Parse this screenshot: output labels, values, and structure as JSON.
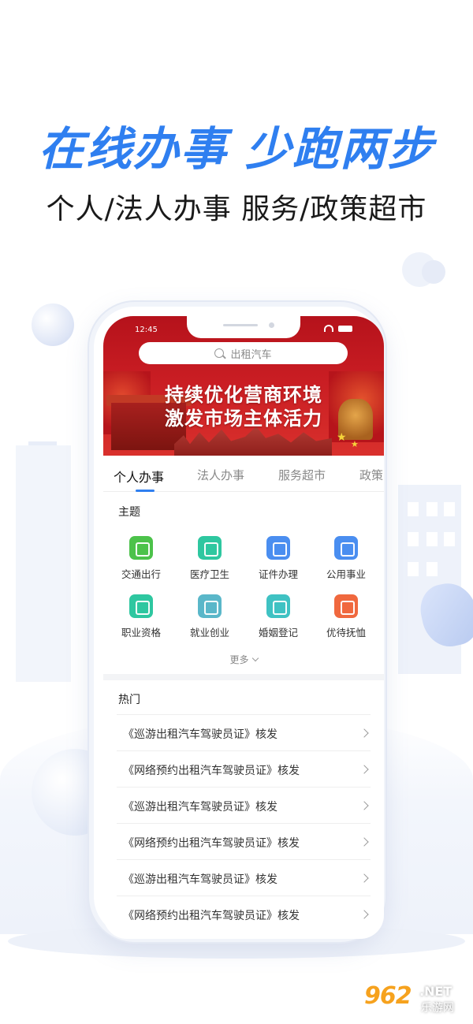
{
  "promo": {
    "headline": "在线办事  少跑两步",
    "subline": "个人/法人办事 服务/政策超市"
  },
  "status_bar": {
    "time": "12:45"
  },
  "search": {
    "placeholder": "出租汽车"
  },
  "banner": {
    "slogan_line1": "持续优化营商环境",
    "slogan_line2": "激发市场主体活力"
  },
  "tabs": [
    {
      "label": "个人办事",
      "active": true
    },
    {
      "label": "法人办事",
      "active": false
    },
    {
      "label": "服务超市",
      "active": false
    },
    {
      "label": "政策",
      "active": false
    }
  ],
  "themes": {
    "title": "主题",
    "items": [
      {
        "label": "交通出行",
        "icon": "car-icon",
        "color": "#4cc24a"
      },
      {
        "label": "医疗卫生",
        "icon": "medical-icon",
        "color": "#2ec7a0"
      },
      {
        "label": "证件办理",
        "icon": "id-card-icon",
        "color": "#4a8ef0"
      },
      {
        "label": "公用事业",
        "icon": "presentation-icon",
        "color": "#4a8ef0"
      },
      {
        "label": "职业资格",
        "icon": "certificate-icon",
        "color": "#2ec7a0"
      },
      {
        "label": "就业创业",
        "icon": "startup-icon",
        "color": "#5ab7c9"
      },
      {
        "label": "婚姻登记",
        "icon": "calendar-heart-icon",
        "color": "#3fc2c3"
      },
      {
        "label": "优待抚恤",
        "icon": "heart-hands-icon",
        "color": "#f0683e"
      }
    ],
    "more_label": "更多"
  },
  "hot": {
    "title": "热门",
    "items": [
      "《巡游出租汽车驾驶员证》核发",
      "《网络预约出租汽车驾驶员证》核发",
      "《巡游出租汽车驾驶员证》核发",
      "《网络预约出租汽车驾驶员证》核发",
      "《巡游出租汽车驾驶员证》核发",
      "《网络预约出租汽车驾驶员证》核发"
    ]
  },
  "watermark": {
    "number": "962",
    "domain": ".NET",
    "site": "乐游网"
  }
}
